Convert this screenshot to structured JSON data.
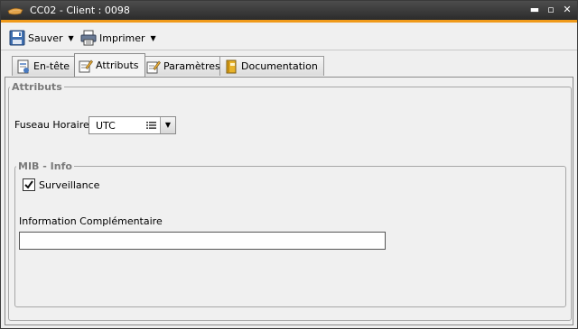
{
  "window": {
    "title": "CC02 - Client : 0098",
    "controls": {
      "minimize": "▬",
      "restore": "▫",
      "close": "✕"
    }
  },
  "toolbar": {
    "save_label": "Sauver",
    "print_label": "Imprimer"
  },
  "tabs": [
    {
      "label": "En-tête",
      "icon": "header-doc-icon"
    },
    {
      "label": "Attributs",
      "icon": "edit-attributes-icon"
    },
    {
      "label": "Paramètres",
      "icon": "parameters-icon"
    },
    {
      "label": "Documentation",
      "icon": "book-icon"
    }
  ],
  "active_tab": "Attributs",
  "attributes": {
    "legend": "Attributs",
    "timezone_label": "Fuseau Horaire:",
    "timezone_value": "UTC"
  },
  "mib": {
    "legend": "MIB - Info",
    "surveillance_label": "Surveillance",
    "surveillance_checked": true,
    "info_label": "Information Complémentaire",
    "info_value": ""
  },
  "colors": {
    "accent": "#f09a1a",
    "titlebar": "#333333",
    "legend_text": "#7a7a7a"
  }
}
